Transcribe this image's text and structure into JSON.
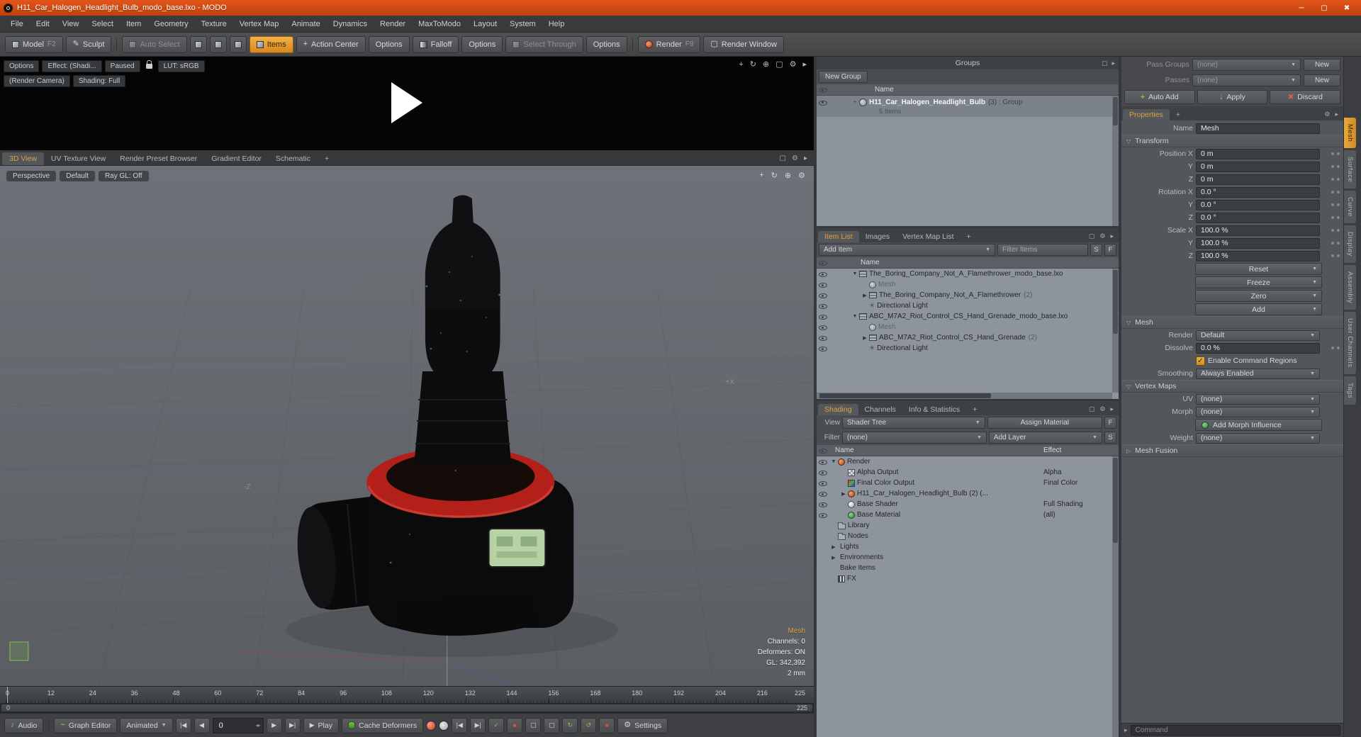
{
  "icons": {
    "minimize": "─",
    "maximize": "▢",
    "close": "✖",
    "gear": "⚙",
    "panel": "▢",
    "flyout": "▸",
    "dropdown": "▼",
    "tree_open": "▼",
    "tree_closed": "▶",
    "sec_open": "▽",
    "sec_closed": "▷",
    "play": "▶",
    "music": "♪",
    "pencil": "✎",
    "sun": "☀",
    "rotate": "↻",
    "rotate_ccw": "↺",
    "zoom": "⊕",
    "pan": "+",
    "check": "✓",
    "cross": "✖",
    "plus": "+",
    "record": "●",
    "stop": "■",
    "step_back": "|◀",
    "step_fwd": "▶|",
    "prev": "◀",
    "next": "▶",
    "spin": "◂▸",
    "arrow_down": "↓",
    "curve": "~",
    "grip": "◢"
  },
  "titlebar": {
    "title": "H11_Car_Halogen_Headlight_Bulb_modo_base.lxo - MODO"
  },
  "menubar": {
    "items": [
      "File",
      "Edit",
      "View",
      "Select",
      "Item",
      "Geometry",
      "Texture",
      "Vertex Map",
      "Animate",
      "Dynamics",
      "Render",
      "MaxToModo",
      "Layout",
      "System",
      "Help"
    ]
  },
  "toolbar": {
    "model": "Model",
    "model_key": "F2",
    "sculpt": "Sculpt",
    "auto_select": "Auto Select",
    "items": "Items",
    "action_center": "Action Center",
    "options1": "Options",
    "falloff": "Falloff",
    "options2": "Options",
    "select_through": "Select Through",
    "options3": "Options",
    "render": "Render",
    "render_key": "F9",
    "render_window": "Render Window"
  },
  "preview": {
    "options": "Options",
    "effect": "Effect: (Shadi...",
    "paused": "Paused",
    "lut": "LUT: sRGB",
    "render_camera": "(Render Camera)",
    "shading": "Shading: Full"
  },
  "viewport_tabs": {
    "tabs": [
      "3D View",
      "UV Texture View",
      "Render Preset Browser",
      "Gradient Editor",
      "Schematic"
    ],
    "add": "+"
  },
  "viewport": {
    "buttons": [
      "Perspective",
      "Default",
      "Ray GL: Off"
    ],
    "axis_x": "+X",
    "axis_z": "-Z",
    "info": {
      "mesh": "Mesh",
      "channels": "Channels: 0",
      "deformers": "Deformers: ON",
      "gl": "GL: 342,392",
      "unit": "2 mm"
    }
  },
  "timeline": {
    "ticks": [
      "0",
      "12",
      "24",
      "36",
      "48",
      "60",
      "72",
      "84",
      "96",
      "108",
      "120",
      "132",
      "144",
      "156",
      "168",
      "180",
      "192",
      "204",
      "216"
    ],
    "end": "225",
    "range_start": "0",
    "range_end": "225"
  },
  "transport": {
    "audio": "Audio",
    "graph_editor": "Graph Editor",
    "animated": "Animated",
    "frame": "0",
    "play": "Play",
    "cache_deformers": "Cache Deformers",
    "settings": "Settings"
  },
  "groups": {
    "title": "Groups",
    "new_group": "New Group",
    "name_col": "Name",
    "row": {
      "name": "H11_Car_Halogen_Headlight_Bulb",
      "suffix": "(3) : Group",
      "sub": "5 Items"
    }
  },
  "item_list": {
    "tabs": [
      "Item List",
      "Images",
      "Vertex Map List"
    ],
    "add_tab": "+",
    "add_item": "Add Item",
    "filter_placeholder": "Filter Items",
    "s": "S",
    "f": "F",
    "name_col": "Name",
    "rows": [
      {
        "label": "The_Boring_Company_Not_A_Flamethrower_modo_base.lxo",
        "suffix": ""
      },
      {
        "label": "Mesh",
        "suffix": ""
      },
      {
        "label": "The_Boring_Company_Not_A_Flamethrower",
        "suffix": "(2)"
      },
      {
        "label": "Directional Light",
        "suffix": ""
      },
      {
        "label": "ABC_M7A2_Riot_Control_CS_Hand_Grenade_modo_base.lxo",
        "suffix": ""
      },
      {
        "label": "Mesh",
        "suffix": ""
      },
      {
        "label": "ABC_M7A2_Riot_Control_CS_Hand_Grenade",
        "suffix": "(2)"
      },
      {
        "label": "Directional Light",
        "suffix": ""
      }
    ]
  },
  "shading": {
    "tabs": [
      "Shading",
      "Channels",
      "Info & Statistics"
    ],
    "add_tab": "+",
    "view_label": "View",
    "view_value": "Shader Tree",
    "assign_material": "Assign Material",
    "f": "F",
    "filter_label": "Filter",
    "filter_value": "(none)",
    "add_layer": "Add Layer",
    "s": "S",
    "name_col": "Name",
    "effect_col": "Effect",
    "rows": [
      {
        "label": "Render",
        "effect": ""
      },
      {
        "label": "Alpha Output",
        "effect": "Alpha"
      },
      {
        "label": "Final Color Output",
        "effect": "Final Color"
      },
      {
        "label": "H11_Car_Halogen_Headlight_Bulb (2) (...",
        "effect": ""
      },
      {
        "label": "Base Shader",
        "effect": "Full Shading"
      },
      {
        "label": "Base Material",
        "effect": "(all)"
      },
      {
        "label": "Library",
        "effect": ""
      },
      {
        "label": "Nodes",
        "effect": ""
      },
      {
        "label": "Lights",
        "effect": ""
      },
      {
        "label": "Environments",
        "effect": ""
      },
      {
        "label": "Bake Items",
        "effect": ""
      },
      {
        "label": "FX",
        "effect": ""
      }
    ]
  },
  "properties": {
    "pass_groups_label": "Pass Groups",
    "pass_groups_value": "(none)",
    "new_button": "New",
    "passes_label": "Passes",
    "passes_value": "(none)",
    "new_button2": "New",
    "auto_add": "Auto Add",
    "apply": "Apply",
    "discard": "Discard",
    "tab": "Properties",
    "add_tab": "+",
    "name_label": "Name",
    "name_value": "Mesh",
    "transform_header": "Transform",
    "transform_rows": [
      {
        "label": "Position X",
        "value": "0 m"
      },
      {
        "label": "Y",
        "value": "0 m"
      },
      {
        "label": "Z",
        "value": "0 m"
      },
      {
        "label": "Rotation X",
        "value": "0.0 °"
      },
      {
        "label": "Y",
        "value": "0.0 °"
      },
      {
        "label": "Z",
        "value": "0.0 °"
      },
      {
        "label": "Scale X",
        "value": "100.0 %"
      },
      {
        "label": "Y",
        "value": "100.0 %"
      },
      {
        "label": "Z",
        "value": "100.0 %"
      }
    ],
    "transform_buttons": [
      "Reset",
      "Freeze",
      "Zero",
      "Add"
    ],
    "mesh_header": "Mesh",
    "render_label": "Render",
    "render_value": "Default",
    "dissolve_label": "Dissolve",
    "dissolve_value": "0.0 %",
    "enable_regions": "Enable Command Regions",
    "smoothing_label": "Smoothing",
    "smoothing_value": "Always Enabled",
    "vertex_maps_header": "Vertex Maps",
    "uv_label": "UV",
    "uv_value": "(none)",
    "morph_label": "Morph",
    "morph_value": "(none)",
    "add_morph": "Add Morph Influence",
    "weight_label": "Weight",
    "weight_value": "(none)",
    "mesh_fusion_header": "Mesh Fusion",
    "command_placeholder": "Command"
  },
  "edge_tabs": {
    "active": "Mesh",
    "items": [
      "Surface",
      "Curve",
      "Display",
      "Assembly",
      "User Channels",
      "Tags"
    ]
  }
}
